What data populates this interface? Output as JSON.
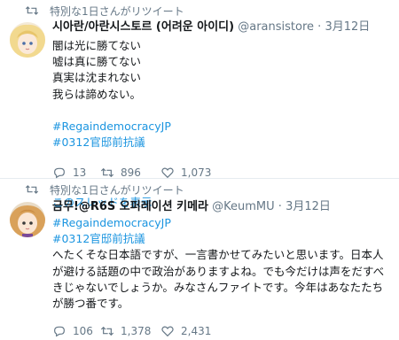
{
  "tweets": [
    {
      "retweet_label": "特別な1日さんがリツイート",
      "author_name": "시아란/아란시스토르 (어려운 아이디)",
      "handle": "@aransistore",
      "separator": "·",
      "time": "3月12日",
      "lines": [
        "闇は光に勝てない",
        "嘘は真に勝てない",
        "真実は沈まれない",
        "我らは諦めない。"
      ],
      "hashtags": [
        "#RegaindemocracyJP",
        "#0312官邸前抗議"
      ],
      "replies": "13",
      "retweets": "896",
      "likes": "1,073",
      "thread_link": "このスレッドを表示"
    },
    {
      "retweet_label": "特別な1日さんがリツイート",
      "author_name": "금무!@R6S 오퍼레이션 키메라",
      "handle": "@KeumMU",
      "separator": "·",
      "time": "3月12日",
      "hashtags": [
        "#RegaindemocracyJP",
        "#0312官邸前抗議"
      ],
      "body": "へたくそな日本語ですが、一言書かせてみたいと思います。日本人が避ける話題の中で政治がありますよね。でも今だけは声をだすべきじゃないでしょうか。みなさんファイトです。今年はあなたたちが勝つ番です。",
      "replies": "106",
      "retweets": "1,378",
      "likes": "2,431"
    }
  ],
  "colors": {
    "link": "#1b95e0",
    "muted": "#657786",
    "text": "#14171a"
  },
  "icons": [
    "retweet-icon",
    "reply-icon",
    "like-icon"
  ]
}
